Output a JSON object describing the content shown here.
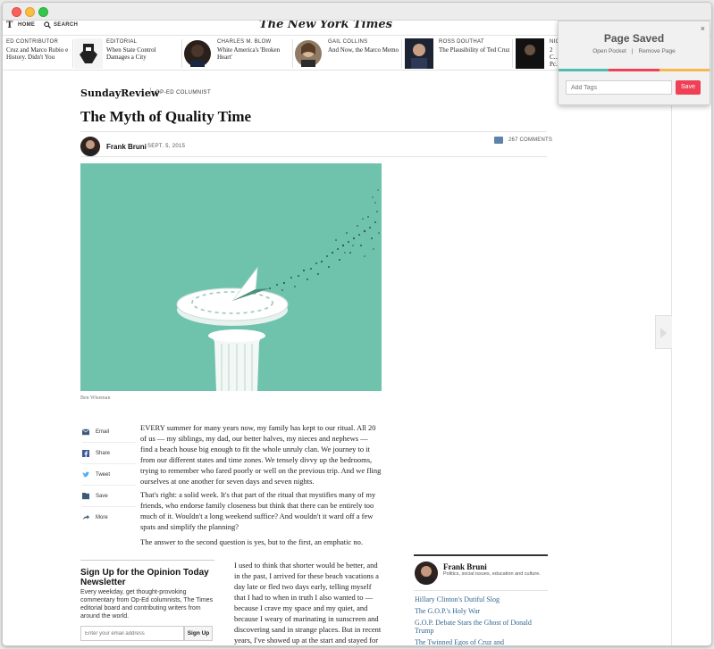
{
  "window": {
    "title": ""
  },
  "nyt": {
    "logo_glyph": "T",
    "nav_home": "HOME",
    "nav_search": "SEARCH",
    "masthead": "The New York Times"
  },
  "ribbon": [
    {
      "kicker": "ED CONTRIBUTOR",
      "headline": "Cruz and Marco Rubio e History. Didn't You"
    },
    {
      "kicker": "EDITORIAL",
      "headline": "When State Control Damages a City"
    },
    {
      "kicker": "CHARLES M. BLOW",
      "headline": "White America's 'Broken Heart'"
    },
    {
      "kicker": "GAIL COLLINS",
      "headline": "And Now, the Marco Memo"
    },
    {
      "kicker": "ROSS DOUTHAT",
      "headline": "The Plausibility of Ted Cruz"
    },
    {
      "kicker": "NIC",
      "headline": "2 C... Pc..."
    }
  ],
  "article": {
    "section": "SundayReview",
    "section_sub": "OP-ED COLUMNIST",
    "headline": "The Myth of Quality Time",
    "author": "Frank Bruni",
    "date": "SEPT. 5, 2015",
    "comments": "267 COMMENTS",
    "image_credit": "Ben Wiseman",
    "paragraphs": [
      "EVERY summer for many years now, my family has kept to our ritual. All 20 of us — my siblings, my dad, our better halves, my nieces and nephews — find a beach house big enough to fit the whole unruly clan. We journey to it from our different states and time zones. We tensely divvy up the bedrooms, trying to remember who fared poorly or well on the previous trip. And we fling ourselves at one another for seven days and seven nights.",
      "That's right: a solid week. It's that part of the ritual that mystifies many of my friends, who endorse family closeness but think that there can be entirely too much of it. Wouldn't a long weekend suffice? And wouldn't it ward off a few spats and simplify the planning?",
      "The answer to the second question is yes, but to the first, an emphatic no.",
      "I used to think that shorter would be better, and in the past, I arrived for these beach vacations a day late or fled two days early, telling myself that I had to when in truth I also wanted to — because I crave my space and my quiet, and because I weary of marinating in sunscreen and discovering sand in strange places. But in recent years, I've showed up at the start and stayed for the"
    ]
  },
  "share": [
    {
      "label": "Email",
      "icon": "envelope-icon"
    },
    {
      "label": "Share",
      "icon": "facebook-icon"
    },
    {
      "label": "Tweet",
      "icon": "twitter-icon"
    },
    {
      "label": "Save",
      "icon": "bookmark-icon"
    },
    {
      "label": "More",
      "icon": "arrow-share-icon"
    }
  ],
  "newsletter": {
    "title": "Sign Up for the Opinion Today Newsletter",
    "description": "Every weekday, get thought-provoking commentary from Op-Ed columnists, The Times editorial board and contributing writers from around the world.",
    "email_placeholder": "Enter your email address",
    "button": "Sign Up"
  },
  "columnist": {
    "name": "Frank Bruni",
    "description": "Politics, social issues, education and culture.",
    "links": [
      "Hillary Clinton's Dutiful Slog",
      "The G.O.P.'s Holy War",
      "G.O.P. Debate Stars the Ghost of Donald Trump",
      "The Twinned Egos of Cruz and"
    ]
  },
  "pocket": {
    "title": "Page Saved",
    "open_link": "Open Pocket",
    "remove_link": "Remove Page",
    "tags_placeholder": "Add Tags",
    "save_button": "Save",
    "close": "×",
    "stripe_colors": [
      "#50bcb6",
      "#ef4056",
      "#fcb64e"
    ]
  },
  "colors": {
    "hero_bg": "#6fc3ad",
    "link": "#326891",
    "pocket_accent": "#ef4056"
  }
}
